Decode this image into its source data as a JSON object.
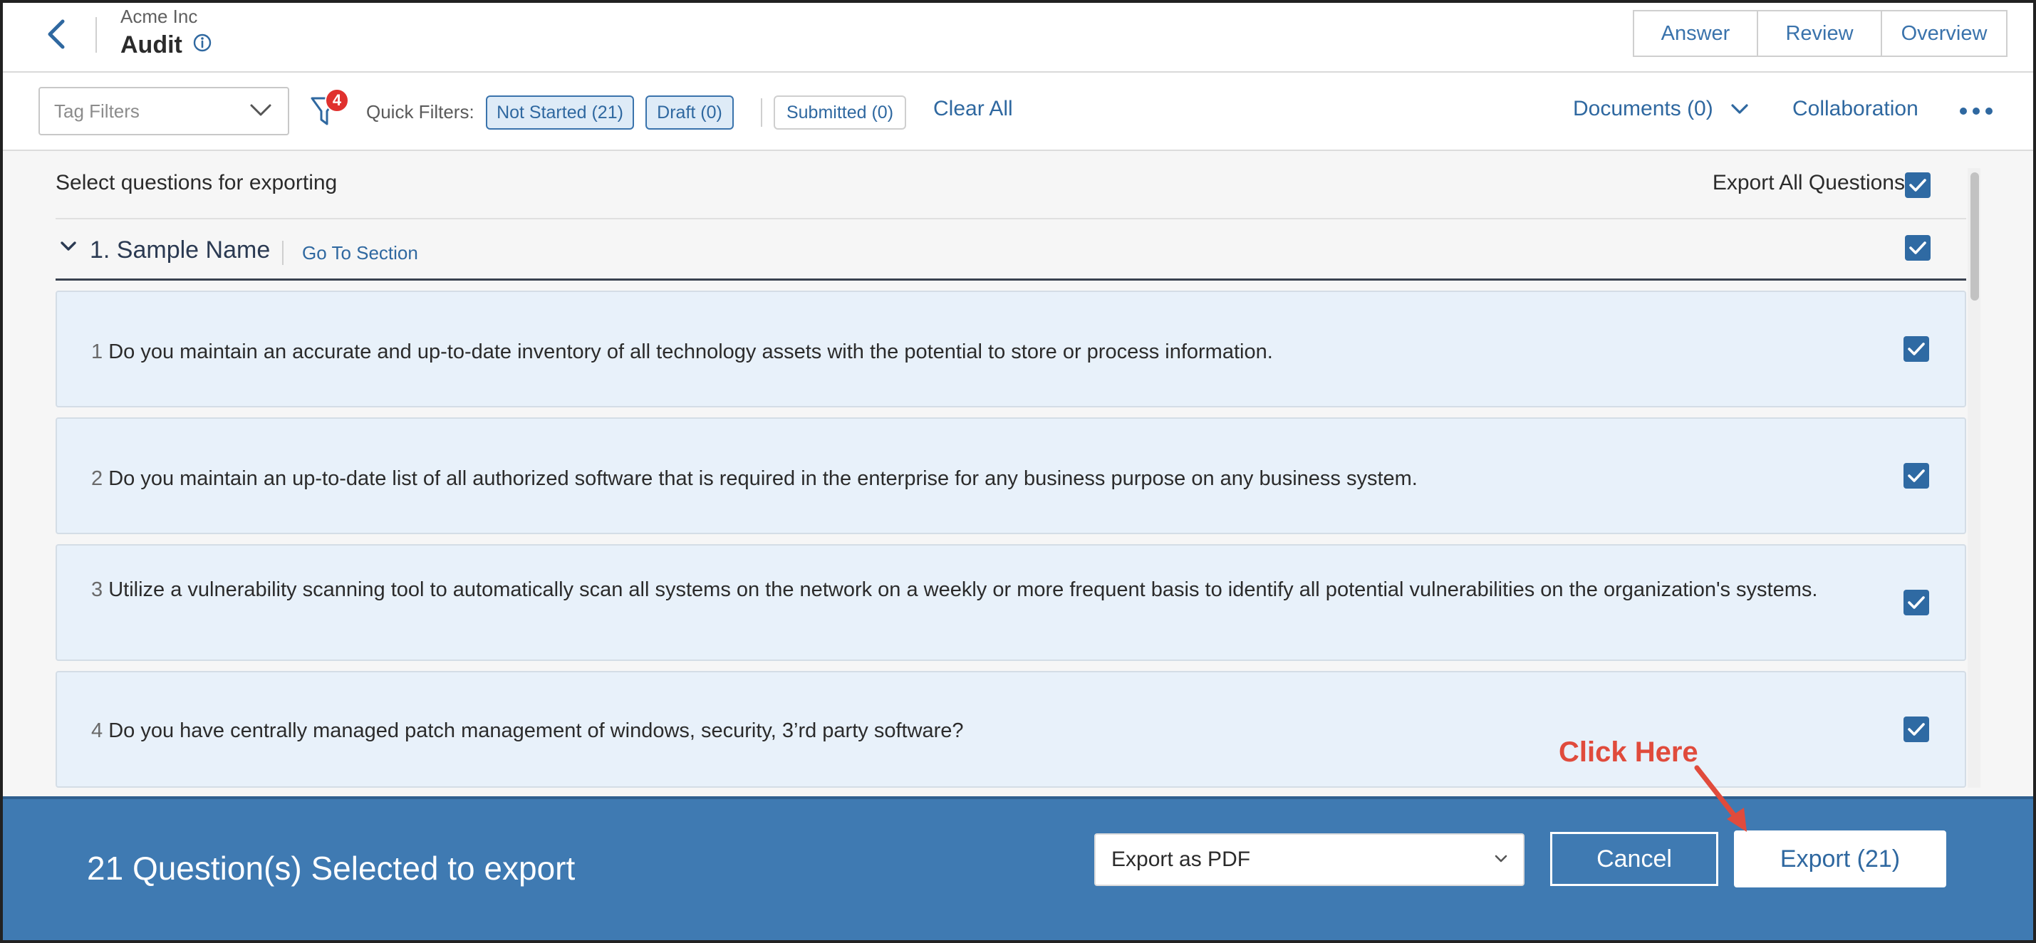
{
  "header": {
    "org_name": "Acme Inc",
    "title": "Audit",
    "tabs": [
      "Answer",
      "Review",
      "Overview"
    ]
  },
  "filters": {
    "tag_placeholder": "Tag Filters",
    "filter_count": "4",
    "quick_filters_label": "Quick Filters:",
    "chips": [
      "Not Started (21)",
      "Draft (0)",
      "Submitted (0)"
    ],
    "clear_all": "Clear All",
    "documents": "Documents (0)",
    "collaboration": "Collaboration"
  },
  "content": {
    "select_label": "Select questions for exporting",
    "export_all_label": "Export All Questions",
    "section": {
      "title": "1. Sample Name",
      "goto": "Go To Section"
    },
    "questions": [
      {
        "num": "1",
        "text": "Do you maintain an accurate and up-to-date inventory of all technology assets with the potential to store or process information."
      },
      {
        "num": "2",
        "text": "Do you maintain an up-to-date list of all authorized software that is required in the enterprise for any business purpose on any business system."
      },
      {
        "num": "3",
        "text": "Utilize a vulnerability scanning tool to automatically scan all systems on the network on a weekly or more frequent basis to identify all potential vulnerabilities on the organization's systems."
      },
      {
        "num": "4",
        "text": "Do you have centrally managed patch management of windows, security, 3’rd party software?"
      }
    ]
  },
  "export_bar": {
    "selected_text": "21 Question(s) Selected to export",
    "format": "Export as PDF",
    "cancel": "Cancel",
    "export": "Export (21)"
  },
  "annotation": {
    "text": "Click Here"
  },
  "colors": {
    "accent": "#2f68a0",
    "export_bar": "#3f7ab2",
    "card_bg": "#e8f1fa",
    "badge": "#e0312e",
    "annotation": "#e04b3c"
  }
}
